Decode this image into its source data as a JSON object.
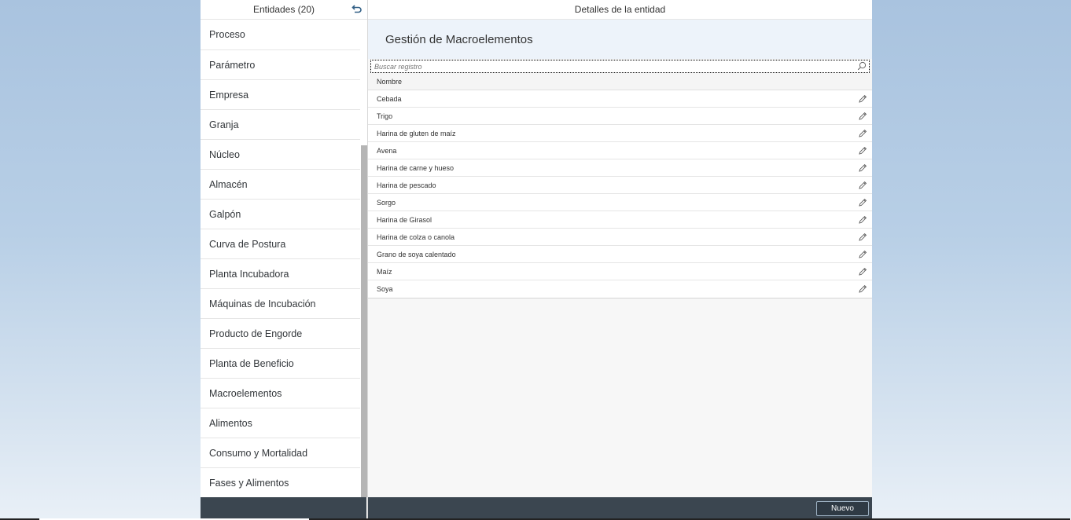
{
  "master": {
    "title": "Entidades (20)",
    "items": [
      {
        "label": "Proceso"
      },
      {
        "label": "Parámetro"
      },
      {
        "label": "Empresa"
      },
      {
        "label": "Granja"
      },
      {
        "label": "Núcleo"
      },
      {
        "label": "Almacén"
      },
      {
        "label": "Galpón"
      },
      {
        "label": "Curva de Postura"
      },
      {
        "label": "Planta Incubadora"
      },
      {
        "label": "Máquinas de Incubación"
      },
      {
        "label": "Producto de Engorde"
      },
      {
        "label": "Planta de Beneficio"
      },
      {
        "label": "Macroelementos"
      },
      {
        "label": "Alimentos"
      },
      {
        "label": "Consumo y Mortalidad"
      },
      {
        "label": "Fases y Alimentos"
      }
    ]
  },
  "detail": {
    "title": "Detalles de la entidad",
    "object_title": "Gestión de Macroelementos",
    "search": {
      "placeholder": "Buscar registro",
      "value": ""
    },
    "table": {
      "column": "Nombre",
      "rows": [
        "Cebada",
        "Trigo",
        "Harina de gluten de maíz",
        "Avena",
        "Harina de carne y hueso",
        "Harina de pescado",
        "Sorgo",
        "Harina de Girasol",
        "Harina de colza o canola",
        "Grano de soya calentado",
        "Maíz",
        "Soya"
      ]
    },
    "footer": {
      "new_label": "Nuevo"
    }
  },
  "icons": {
    "back": "back-arrow-icon",
    "search": "search-icon",
    "edit": "pencil-icon"
  }
}
